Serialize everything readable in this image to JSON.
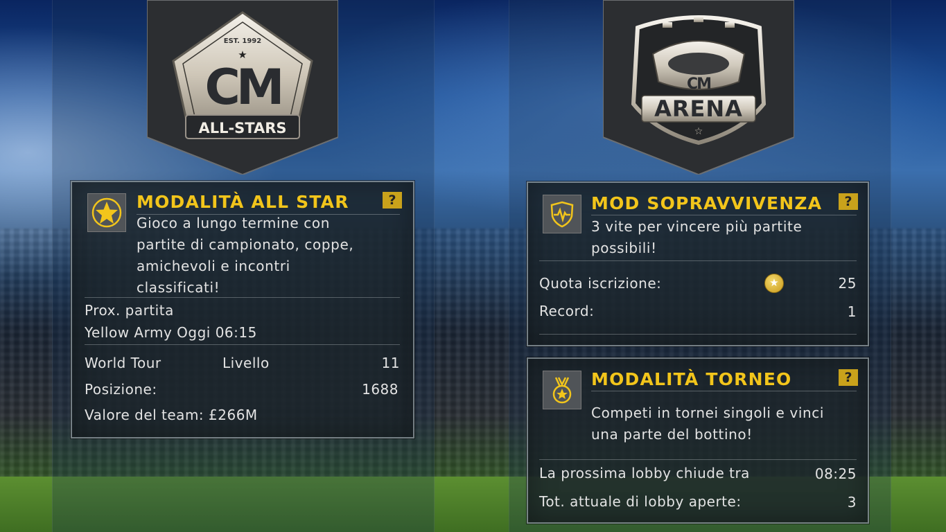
{
  "logos": {
    "all_stars": {
      "top_text": "EST. 1992",
      "mark": "CM",
      "banner": "ALL-STARS"
    },
    "arena": {
      "mark": "CM",
      "banner": "ARENA"
    }
  },
  "all_star": {
    "icon": "star-badge-icon",
    "title": "MODALITÀ ALL STAR",
    "help": "?",
    "description_lines": [
      "Gioco a lungo termine con",
      "partite di campionato, coppe,",
      "amichevoli e incontri",
      "classificati!"
    ],
    "next_match_label": "Prox. partita",
    "next_match_value": "Yellow Army Oggi 06:15",
    "tour_label": "World Tour",
    "level_label": "Livello",
    "level_value": "11",
    "position_label": "Posizione:",
    "position_value": "1688",
    "team_value_text": "Valore del team: £266M"
  },
  "survival": {
    "icon": "heartbeat-shield-icon",
    "title": "MOD SOPRAVVIVENZA",
    "help": "?",
    "description_lines": [
      "3 vite per vincere più partite",
      "possibili!"
    ],
    "entry_fee_label": "Quota iscrizione:",
    "coin_icon": "star-coin-icon",
    "entry_fee_value": "25",
    "record_label": "Record:",
    "record_value": "1"
  },
  "tournament": {
    "icon": "medal-icon",
    "title": "MODALITÀ TORNEO",
    "help": "?",
    "description_lines": [
      "Competi in tornei singoli e vinci",
      "una parte del bottino!"
    ],
    "lobby_closes_label": "La prossima lobby chiude tra",
    "lobby_closes_value": "08:25",
    "open_lobbies_label": "Tot. attuale di lobby aperte:",
    "open_lobbies_value": "3"
  },
  "colors": {
    "accent": "#f2c51b",
    "help_bg": "#c9a21b"
  }
}
